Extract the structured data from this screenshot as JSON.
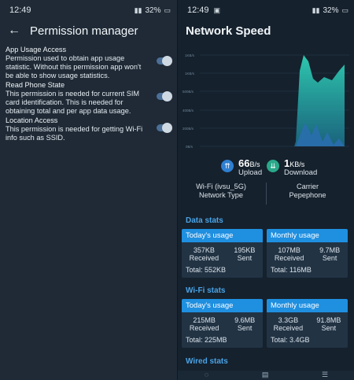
{
  "left_status": {
    "time": "12:49",
    "battery": "32%"
  },
  "right_status": {
    "time": "12:49",
    "battery": "32%"
  },
  "permission_screen": {
    "title": "Permission manager",
    "items": [
      {
        "title": "App Usage Access",
        "desc": "Permission used to obtain app usage statistic. Without this permission app won't be able to show usage statistics."
      },
      {
        "title": "Read Phone State",
        "desc": "This permission is needed for current SIM card identification. This is needed for obtaining total and per app data usage."
      },
      {
        "title": "Location Access",
        "desc": "This permission is needed for getting Wi-Fi info such as SSID."
      }
    ]
  },
  "network_screen": {
    "title": "Network Speed",
    "chart_axis": [
      "1KB/s",
      "1KB/s",
      "500B/s",
      "400B/s",
      "200B/s",
      "0B/s"
    ],
    "upload": {
      "value": "66",
      "unit": "B/s",
      "label": "Upload"
    },
    "download": {
      "value": "1",
      "unit": "KB/s",
      "label": "Download"
    },
    "network_type": {
      "value": "Wi-Fi (ivsu_5G)",
      "label": "Network Type"
    },
    "carrier": {
      "label": "Carrier",
      "value": "Pepephone"
    },
    "data_stats": {
      "title": "Data stats",
      "today": {
        "header": "Today's usage",
        "received": "357KB",
        "received_label": "Received",
        "sent": "195KB",
        "sent_label": "Sent",
        "total": "Total: 552KB"
      },
      "monthly": {
        "header": "Monthly usage",
        "received": "107MB",
        "received_label": "Received",
        "sent": "9.7MB",
        "sent_label": "Sent",
        "total": "Total: 116MB"
      }
    },
    "wifi_stats": {
      "title": "Wi-Fi stats",
      "today": {
        "header": "Today's usage",
        "received": "215MB",
        "received_label": "Received",
        "sent": "9.6MB",
        "sent_label": "Sent",
        "total": "Total: 225MB"
      },
      "monthly": {
        "header": "Monthly usage",
        "received": "3.3GB",
        "received_label": "Received",
        "sent": "91.8MB",
        "sent_label": "Sent",
        "total": "Total: 3.4GB"
      }
    },
    "wired_stats": {
      "title": "Wired stats"
    }
  },
  "colors": {
    "accent": "#1f8fe0",
    "upload": "#2f7fd1",
    "download": "#2aa88a",
    "chart_fill": "#2fd0b5"
  }
}
